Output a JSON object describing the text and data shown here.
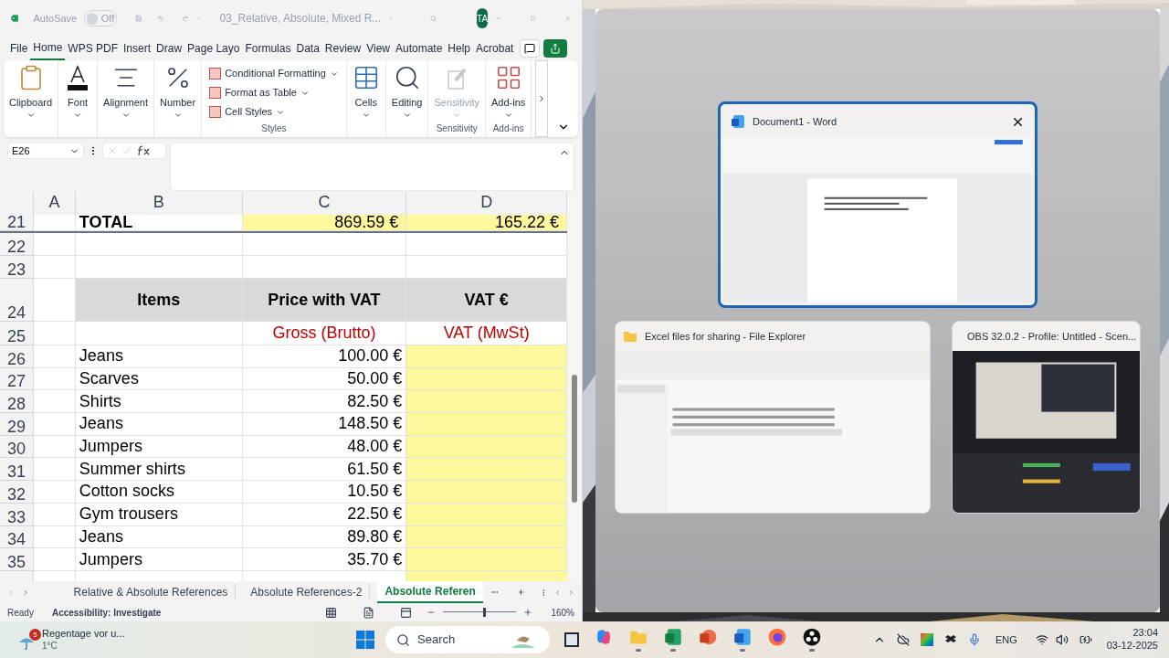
{
  "excel": {
    "autosave": {
      "label": "AutoSave",
      "on": false,
      "state_text": "Off"
    },
    "file_name": "03_Relative, Absolute, Mixed R...",
    "avatar": "TA",
    "ribbon_tabs": [
      {
        "label": "File",
        "selected": false
      },
      {
        "label": "Home",
        "selected": true
      },
      {
        "label": "WPS PDF",
        "selected": false
      },
      {
        "label": "Insert",
        "selected": false
      },
      {
        "label": "Draw",
        "selected": false
      },
      {
        "label": "Page Layo",
        "selected": false
      },
      {
        "label": "Formulas",
        "selected": false
      },
      {
        "label": "Data",
        "selected": false
      },
      {
        "label": "Review",
        "selected": false
      },
      {
        "label": "View",
        "selected": false
      },
      {
        "label": "Automate",
        "selected": false
      },
      {
        "label": "Help",
        "selected": false
      },
      {
        "label": "Acrobat",
        "selected": false
      }
    ],
    "ribbon_groups": [
      {
        "kind": "button",
        "label": "Clipboard",
        "disabled": false
      },
      {
        "kind": "button",
        "label": "Font",
        "disabled": false
      },
      {
        "kind": "button",
        "label": "Alignment",
        "disabled": false
      },
      {
        "kind": "button",
        "label": "Number",
        "disabled": false
      },
      {
        "kind": "list",
        "items": [
          "Conditional Formatting",
          "Format as Table",
          "Cell Styles"
        ],
        "caption": "Styles"
      },
      {
        "kind": "button",
        "label": "Cells",
        "disabled": false
      },
      {
        "kind": "button",
        "label": "Editing",
        "disabled": false
      },
      {
        "kind": "button",
        "label": "Sensitivity",
        "disabled": true,
        "caption": "Sensitivity"
      },
      {
        "kind": "button",
        "label": "Add-ins",
        "disabled": false,
        "caption": "Add-ins"
      }
    ],
    "name_box": "E26",
    "columns": [
      "A",
      "B",
      "C",
      "D"
    ],
    "rows": [
      {
        "number": "21",
        "kind": "total",
        "b": "TOTAL",
        "c": "869.59 €",
        "d": "165.22 €"
      },
      {
        "number": "22",
        "kind": "blank"
      },
      {
        "number": "23",
        "kind": "blank"
      },
      {
        "number": "24",
        "kind": "header",
        "b": "Items",
        "c": "Price with VAT",
        "d": "VAT €"
      },
      {
        "number": "25",
        "kind": "subheader",
        "c": "Gross (Brutto)",
        "d": "VAT (MwSt)"
      },
      {
        "number": "26",
        "kind": "item",
        "b": "Jeans",
        "c": "100.00 €"
      },
      {
        "number": "27",
        "kind": "item",
        "b": "Scarves",
        "c": "50.00 €"
      },
      {
        "number": "28",
        "kind": "item",
        "b": "Shirts",
        "c": "82.50 €"
      },
      {
        "number": "29",
        "kind": "item",
        "b": "Jeans",
        "c": "148.50 €"
      },
      {
        "number": "30",
        "kind": "item",
        "b": "Jumpers",
        "c": "48.00 €"
      },
      {
        "number": "31",
        "kind": "item",
        "b": "Summer shirts",
        "c": "61.50 €"
      },
      {
        "number": "32",
        "kind": "item",
        "b": "Cotton socks",
        "c": "10.50 €"
      },
      {
        "number": "33",
        "kind": "item",
        "b": "Gym trousers",
        "c": "22.50 €"
      },
      {
        "number": "34",
        "kind": "item",
        "b": "Jeans",
        "c": "89.80 €"
      },
      {
        "number": "35",
        "kind": "item",
        "b": "Jumpers",
        "c": "35.70 €"
      }
    ],
    "sheet_tabs": [
      {
        "label": "Relative & Absolute References",
        "selected": false
      },
      {
        "label": "Absolute References-2",
        "selected": false
      },
      {
        "label": "Absolute Referen",
        "selected": true
      }
    ],
    "status": {
      "mode": "Ready",
      "accessibility": "Accessibility: Investigate",
      "zoom": "160%",
      "level": 0.55
    }
  },
  "snap_windows": [
    {
      "title": "Document1 - Word",
      "kind": "word",
      "selected": true
    },
    {
      "title": "Excel files for sharing - File Explorer",
      "kind": "explorer",
      "selected": false
    },
    {
      "title": "OBS 32.0.2 - Profile: Untitled - Scen...",
      "kind": "obs",
      "selected": false
    }
  ],
  "taskbar": {
    "weather": {
      "badge": "5",
      "text": "Regentage vor u...",
      "temp": "1°C"
    },
    "search": "Search",
    "apps": [
      {
        "kind": "copilot",
        "running": false
      },
      {
        "kind": "explorer",
        "running": true
      },
      {
        "kind": "excel",
        "running": true
      },
      {
        "kind": "powerpoint",
        "running": false
      },
      {
        "kind": "word",
        "running": true
      },
      {
        "kind": "firefox",
        "running": false
      },
      {
        "kind": "obs",
        "running": true
      }
    ],
    "language": "ENG",
    "time": "23:04",
    "date": "03-12-2025"
  }
}
